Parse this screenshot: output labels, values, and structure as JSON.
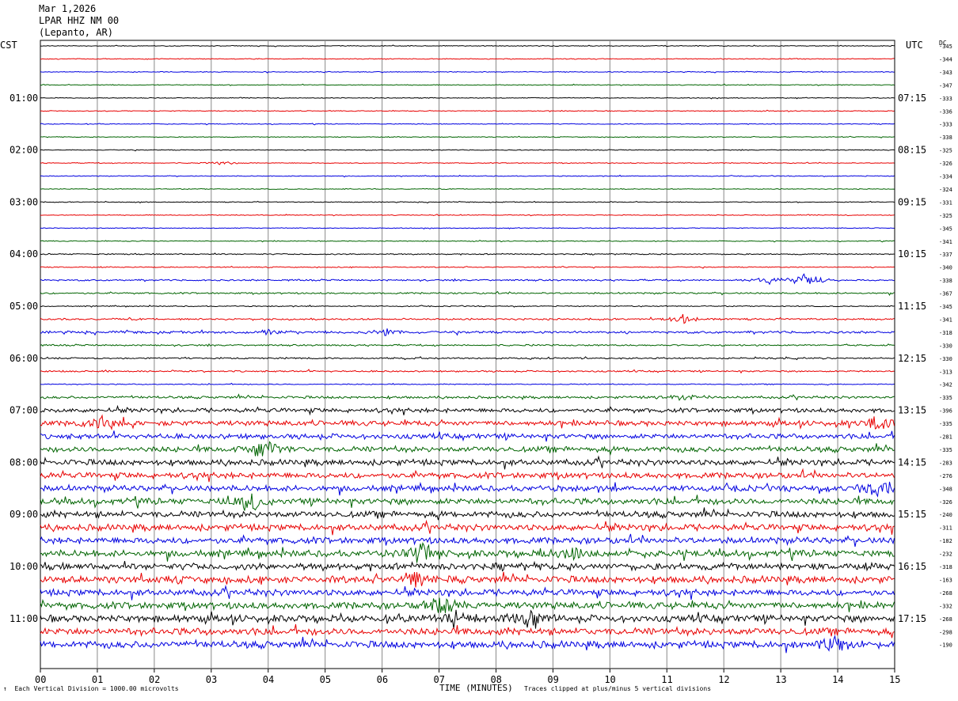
{
  "header": {
    "date": "Mar 1,2026",
    "station": "LPAR HHZ NM 00",
    "location": "(Lepanto, AR)"
  },
  "labels": {
    "left_tz": "CST",
    "right_tz": "UTC",
    "dc": "DC"
  },
  "footer": {
    "scale_note": "Each Vertical Division = 1000.00 microvolts",
    "clip_note": "Traces clipped at plus/minus 5 vertical divisions",
    "corner_mark": "↑"
  },
  "chart_data": {
    "type": "line",
    "title": "",
    "xlabel": "TIME (MINUTES)",
    "x_ticks": [
      "00",
      "01",
      "02",
      "03",
      "04",
      "05",
      "06",
      "07",
      "08",
      "09",
      "10",
      "11",
      "12",
      "13",
      "14",
      "15"
    ],
    "xlim": [
      0,
      15
    ],
    "line_interval_minutes": 15,
    "left_time_labels": [
      "01:00",
      "02:00",
      "03:00",
      "04:00",
      "05:00",
      "06:00",
      "07:00",
      "08:00",
      "09:00",
      "10:00",
      "11:00"
    ],
    "right_time_labels": [
      "07:15",
      "08:15",
      "09:15",
      "10:15",
      "11:15",
      "12:15",
      "13:15",
      "14:15",
      "15:15",
      "16:15",
      "17:15"
    ],
    "trace_colors": [
      "#000000",
      "#e80000",
      "#0000e0",
      "#006400"
    ],
    "dc_offsets": [
      -345,
      -344,
      -343,
      -347,
      -333,
      -336,
      -333,
      -338,
      -325,
      -326,
      -334,
      -324,
      -331,
      -325,
      -345,
      -341,
      -337,
      -340,
      -338,
      -367,
      -345,
      -341,
      -318,
      -330,
      -330,
      -313,
      -342,
      -335,
      -396,
      -335,
      -281,
      -335,
      -283,
      -276,
      -348,
      -326,
      -240,
      -311,
      -182,
      -232,
      -318,
      -163,
      -268,
      -332,
      -268,
      -298,
      -190
    ],
    "trace_activity": [
      0.4,
      0.4,
      0.4,
      0.4,
      0.4,
      0.4,
      0.4,
      0.4,
      0.4,
      0.4,
      0.4,
      0.4,
      0.4,
      0.4,
      0.4,
      0.4,
      0.6,
      0.5,
      0.8,
      0.8,
      0.5,
      0.9,
      1.2,
      0.8,
      0.8,
      0.8,
      0.5,
      1.3,
      2.2,
      2.6,
      2.6,
      2.8,
      3.0,
      3.0,
      3.0,
      3.2,
      3.2,
      3.3,
      3.3,
      3.4,
      3.4,
      3.6,
      3.3,
      3.5,
      3.6,
      3.6,
      3.6
    ],
    "events": [
      {
        "trace": 9,
        "minute": 3.2,
        "amplitude": 2
      },
      {
        "trace": 18,
        "minute": 13.5,
        "amplitude": 9
      },
      {
        "trace": 18,
        "minute": 12.8,
        "amplitude": 4
      },
      {
        "trace": 21,
        "minute": 11.3,
        "amplitude": 5
      },
      {
        "trace": 22,
        "minute": 6.1,
        "amplitude": 5
      },
      {
        "trace": 22,
        "minute": 4.0,
        "amplitude": 3
      },
      {
        "trace": 27,
        "minute": 11.3,
        "amplitude": 4
      },
      {
        "trace": 29,
        "minute": 1.1,
        "amplitude": 7
      },
      {
        "trace": 29,
        "minute": 14.7,
        "amplitude": 7
      },
      {
        "trace": 31,
        "minute": 3.9,
        "amplitude": 11
      },
      {
        "trace": 34,
        "minute": 14.7,
        "amplitude": 9
      },
      {
        "trace": 35,
        "minute": 3.7,
        "amplitude": 11
      },
      {
        "trace": 39,
        "minute": 6.7,
        "amplitude": 10
      },
      {
        "trace": 39,
        "minute": 9.3,
        "amplitude": 8
      },
      {
        "trace": 41,
        "minute": 6.6,
        "amplitude": 10
      },
      {
        "trace": 43,
        "minute": 7.1,
        "amplitude": 11
      },
      {
        "trace": 44,
        "minute": 8.6,
        "amplitude": 12
      },
      {
        "trace": 44,
        "minute": 7.3,
        "amplitude": 9
      },
      {
        "trace": 46,
        "minute": 13.9,
        "amplitude": 9
      }
    ]
  }
}
